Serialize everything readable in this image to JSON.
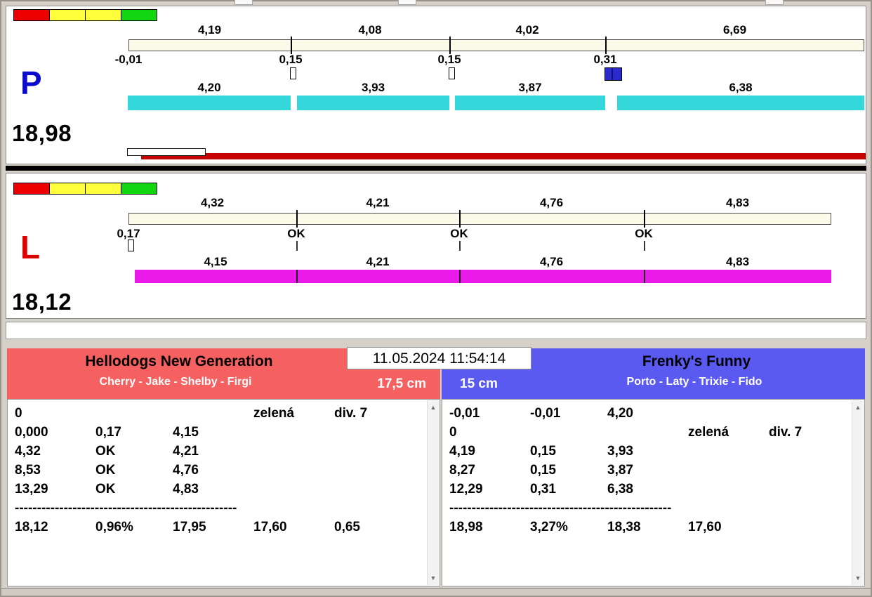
{
  "window": {
    "timestamp": "11.05.2024 11:54:14"
  },
  "lanes": [
    {
      "letter": "P",
      "letter_color": "#0b0bd0",
      "total_label": "18,98",
      "lights": [
        "#ec0000",
        "#ffff3c",
        "#ffff3c",
        "#12d612"
      ],
      "splits": {
        "values": [
          4.19,
          4.08,
          4.02,
          6.69
        ],
        "labels": [
          "4,19",
          "4,08",
          "4,02",
          "6,69"
        ]
      },
      "offsets": [
        {
          "label": "-0,01",
          "value": -0.01,
          "marker": "none"
        },
        {
          "label": "0,15",
          "value": 0.15,
          "marker": "small-box"
        },
        {
          "label": "0,15",
          "value": 0.15,
          "marker": "small-box"
        },
        {
          "label": "0,31",
          "value": 0.31,
          "marker": "blue-box"
        }
      ],
      "dogs": {
        "color": "#35d8da",
        "values": [
          4.2,
          3.93,
          3.87,
          6.38
        ],
        "labels": [
          "4,20",
          "3,93",
          "3,87",
          "6,38"
        ],
        "style": "gapped"
      },
      "progress_bar": true
    },
    {
      "letter": "L",
      "letter_color": "#e00000",
      "total_label": "18,12",
      "lights": [
        "#ec0000",
        "#ffff3c",
        "#ffff3c",
        "#12d612"
      ],
      "splits": {
        "values": [
          4.32,
          4.21,
          4.76,
          4.83
        ],
        "labels": [
          "4,32",
          "4,21",
          "4,76",
          "4,83"
        ]
      },
      "offsets": [
        {
          "label": "0,17",
          "value": 0.17,
          "marker": "small-box"
        },
        {
          "label": "OK",
          "value": 0,
          "marker": "tick"
        },
        {
          "label": "OK",
          "value": 0,
          "marker": "tick"
        },
        {
          "label": "OK",
          "value": 0,
          "marker": "tick"
        }
      ],
      "dogs": {
        "color": "#ea1bea",
        "values": [
          4.15,
          4.21,
          4.76,
          4.83
        ],
        "labels": [
          "4,15",
          "4,21",
          "4,76",
          "4,83"
        ],
        "style": "joined"
      },
      "progress_bar": false
    }
  ],
  "teams": [
    {
      "name": "Hellodogs New Generation",
      "dogs_line": "Cherry - Jake - Shelby - Firgi",
      "jump_height": "17,5 cm",
      "header_color": "#f56060",
      "rows": [
        [
          "0",
          "",
          "",
          "zelená",
          "div. 7"
        ],
        [
          "0,000",
          "0,17",
          "4,15",
          "",
          ""
        ],
        [
          "4,32",
          "OK",
          "4,21",
          "",
          ""
        ],
        [
          "8,53",
          "OK",
          "4,76",
          "",
          ""
        ],
        [
          "13,29",
          "OK",
          "4,83",
          "",
          ""
        ]
      ],
      "separator": "--------------------------------------------------",
      "total_row": [
        "18,12",
        "0,96%",
        "17,95",
        "17,60",
        "0,65"
      ]
    },
    {
      "name": "Frenky's Funny",
      "dogs_line": "Porto - Laty - Trixie - Fido",
      "jump_height": "15 cm",
      "header_color": "#5a5af0",
      "rows": [
        [
          "-0,01",
          "-0,01",
          "4,20",
          "",
          ""
        ],
        [
          "0",
          "",
          "",
          "zelená",
          "div. 7"
        ],
        [
          "4,19",
          "0,15",
          "3,93",
          "",
          ""
        ],
        [
          "8,27",
          "0,15",
          "3,87",
          "",
          ""
        ],
        [
          "12,29",
          "0,31",
          "6,38",
          "",
          ""
        ]
      ],
      "separator": "--------------------------------------------------",
      "total_row": [
        "18,98",
        "3,27%",
        "18,38",
        "17,60",
        ""
      ]
    }
  ]
}
